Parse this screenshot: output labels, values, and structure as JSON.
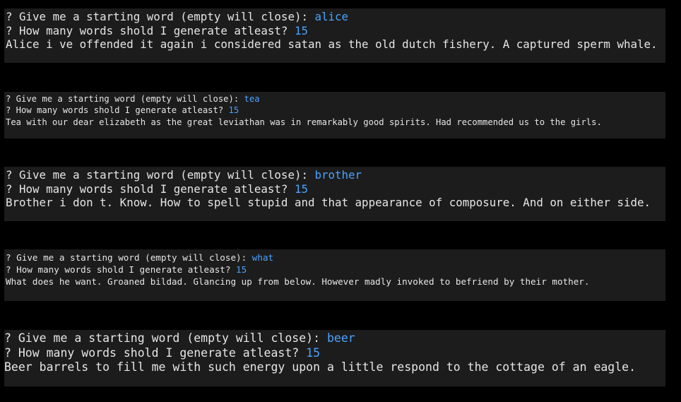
{
  "colors": {
    "background": "#000000",
    "panel": "#1c1c1c",
    "text": "#e6e6e6",
    "answer": "#4aa3ff"
  },
  "sessions": [
    {
      "prompt_word": "? Give me a starting word (empty will close): ",
      "word": "alice",
      "prompt_count": "? How many words shold I generate atleast? ",
      "count": "15",
      "output": "Alice i ve offended it again i considered satan as the old dutch fishery. A captured sperm whale."
    },
    {
      "prompt_word": "? Give me a starting word (empty will close): ",
      "word": "tea",
      "prompt_count": "? How many words shold I generate atleast? ",
      "count": "15",
      "output": "Tea with our dear elizabeth as the great leviathan was in remarkably good spirits. Had recommended us to the girls."
    },
    {
      "prompt_word": "? Give me a starting word (empty will close): ",
      "word": "brother",
      "prompt_count": "? How many words shold I generate atleast? ",
      "count": "15",
      "output": "Brother i don t. Know. How to spell stupid and that appearance of composure. And on either side."
    },
    {
      "prompt_word": "? Give me a starting word (empty will close): ",
      "word": "what",
      "prompt_count": "? How many words shold I generate atleast? ",
      "count": "15",
      "output": "What does he want. Groaned bildad. Glancing up from below. However madly invoked to befriend by their mother."
    },
    {
      "prompt_word": "? Give me a starting word (empty will close): ",
      "word": "beer",
      "prompt_count": "? How many words shold I generate atleast? ",
      "count": "15",
      "output": "Beer barrels to fill me with such energy upon a little respond to the cottage of an eagle."
    }
  ]
}
